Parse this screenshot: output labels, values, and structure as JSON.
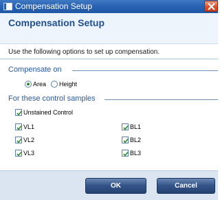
{
  "window": {
    "title": "Compensation Setup"
  },
  "header": {
    "title": "Compensation Setup",
    "description": "Use the following options to set up compensation."
  },
  "compensate_on": {
    "label": "Compensate on",
    "options": [
      {
        "label": "Area",
        "selected": true
      },
      {
        "label": "Height",
        "selected": false
      }
    ]
  },
  "control_samples": {
    "label": "For these control samples",
    "unstained": {
      "label": "Unstained Control",
      "checked": true
    },
    "left": [
      {
        "label": "VL1",
        "checked": true
      },
      {
        "label": "VL2",
        "checked": true
      },
      {
        "label": "VL3",
        "checked": true
      }
    ],
    "right": [
      {
        "label": "BL1",
        "checked": true
      },
      {
        "label": "BL2",
        "checked": true
      },
      {
        "label": "BL3",
        "checked": true
      }
    ]
  },
  "footer": {
    "ok_label": "OK",
    "cancel_label": "Cancel"
  },
  "colors": {
    "title_bar": "#2b64b4",
    "accent_text": "#2a5aa0",
    "check_green": "#2f8a2f",
    "button": "#34558a",
    "close_button": "#d6542e"
  },
  "icons": [
    "window-icon",
    "close-icon",
    "check-icon",
    "radio-dot-icon"
  ]
}
